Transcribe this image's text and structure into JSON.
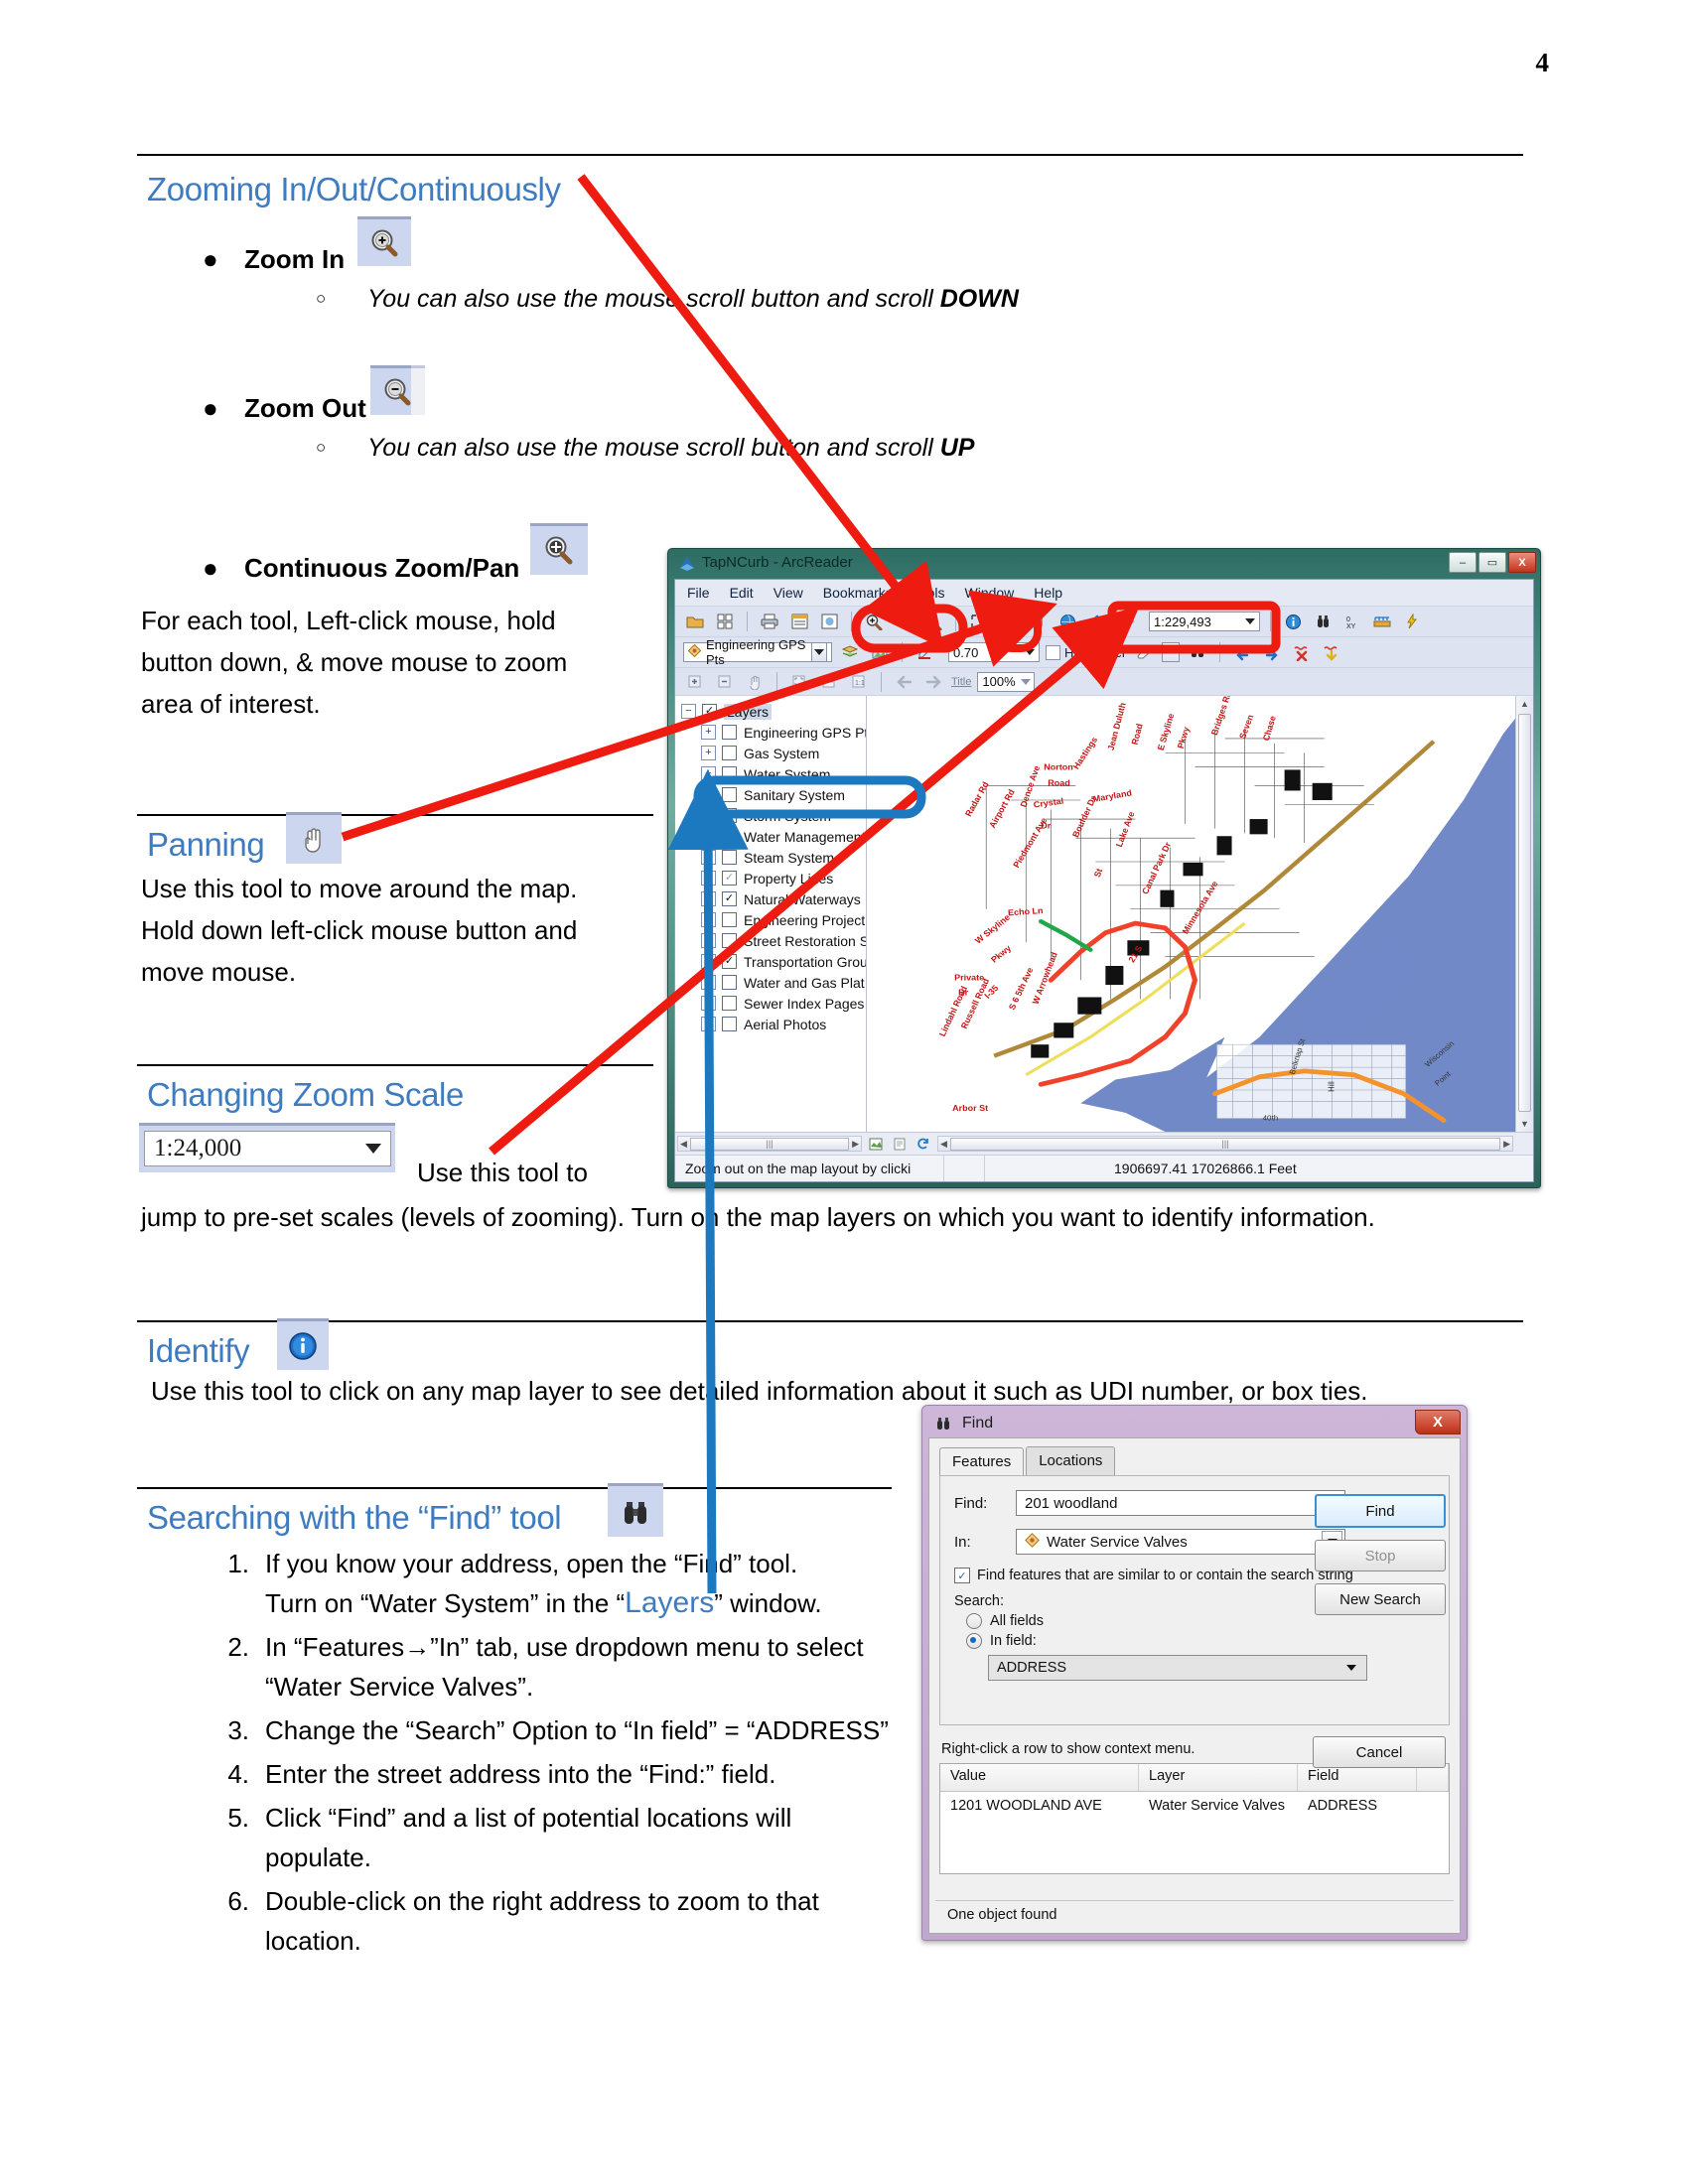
{
  "page": {
    "number": "4"
  },
  "sections": {
    "zooming": {
      "heading": "Zooming In/Out/Continuously",
      "items": [
        {
          "label": "Zoom In",
          "icon": "zoom-in-icon",
          "note_pre": "You can also use the mouse scroll button and scroll ",
          "note_em": "DOWN"
        },
        {
          "label": "Zoom Out",
          "icon": "zoom-out-icon",
          "note_pre": "You can also use the mouse scroll button and scroll ",
          "note_em": "UP"
        },
        {
          "label": "Continuous Zoom/Pan",
          "icon": "continuous-zoom-pan-icon",
          "note_pre": "",
          "note_em": ""
        }
      ],
      "paragraph": "For each tool, Left-click mouse, hold button down, & move mouse to zoom area of interest."
    },
    "panning": {
      "heading": "Panning",
      "icon": "pan-hand-icon",
      "paragraph": "Use this tool to move around the map. Hold down left-click mouse button and move mouse."
    },
    "zoom_scale": {
      "heading": "Changing Zoom Scale",
      "scale_value": "1:24,000",
      "paragraph_a": "Use this tool to",
      "paragraph_b": "jump to pre-set scales (levels of zooming).  Turn on the map layers on which you want to identify information."
    },
    "identify": {
      "heading": "Identify",
      "icon": "identify-info-icon",
      "paragraph": "Use this tool to click on any map layer to see detailed information about it such as UDI number, or box ties."
    },
    "find": {
      "heading": "Searching with the “Find” tool",
      "icon": "binoculars-icon",
      "steps": [
        {
          "n": "1.",
          "text_a": "If you know your address, open the “Find” tool.",
          "text_b_pre": "Turn on “Water System” in the “",
          "text_b_blue": "Layers",
          "text_b_post": "” window."
        },
        {
          "n": "2.",
          "text_a": "In “Features→”In” tab, use dropdown menu to select “Water Service Valves”."
        },
        {
          "n": "3.",
          "text_a": "Change the “Search” Option to “In field” = “ADDRESS”"
        },
        {
          "n": "4.",
          "text_a": "Enter the street address into the “Find:” field."
        },
        {
          "n": "5.",
          "text_a": "Click “Find” and a list of potential locations will populate."
        },
        {
          "n": "6.",
          "text_a": "Double-click on the right address to zoom to that location."
        }
      ]
    }
  },
  "arcreader": {
    "title": "TapNCurb - ArcReader",
    "window_buttons": {
      "minimize": "–",
      "maximize": "▭",
      "close": "X"
    },
    "menu": [
      "File",
      "Edit",
      "View",
      "Bookmarks",
      "Tools",
      "Window",
      "Help"
    ],
    "toolbar_icons": [
      "open-icon",
      "pages-icon",
      "print-icon",
      "content-icon",
      "layout-icon",
      "zoom-in-icon",
      "zoom-out-icon",
      "continuous-zoom-pan-icon",
      "fixed-zoom-in-icon",
      "full-extent-icon",
      "pan-hand-icon",
      "globe-icon",
      "back-extent-icon",
      "forward-extent-icon"
    ],
    "scale_value": "1:229,493",
    "right_tool_icons": [
      "identify-info-icon",
      "binoculars-icon",
      "xy-icon",
      "measure-icon",
      "hyperlink-icon"
    ],
    "layer_combo_value": "Engineering GPS Pts",
    "line_width_value": "0.70",
    "highlighter_label": "Highlighter",
    "zoom_percent_label": "Title",
    "zoom_percent_value": "100%",
    "toc": {
      "root": "Layers",
      "layers": [
        {
          "label": "Engineering GPS Pts",
          "checked": false
        },
        {
          "label": "Gas System",
          "checked": false
        },
        {
          "label": "Water System",
          "checked": false,
          "highlight": true
        },
        {
          "label": "Sanitary System",
          "checked": false
        },
        {
          "label": "Storm System",
          "checked": false
        },
        {
          "label": "Water Management Featu",
          "checked": false
        },
        {
          "label": "Steam System",
          "checked": false
        },
        {
          "label": "Property Lines",
          "checked": "gray"
        },
        {
          "label": "Natural Waterways",
          "checked": true
        },
        {
          "label": "Engineering Project Areas",
          "checked": false
        },
        {
          "label": "Street Restoration Sites",
          "checked": false
        },
        {
          "label": "Transportation Group",
          "checked": true
        },
        {
          "label": "Water and Gas Plat Index",
          "checked": false
        },
        {
          "label": "Sewer Index Pages",
          "checked": false
        },
        {
          "label": "Aerial Photos",
          "checked": false
        }
      ]
    },
    "map_labels": [
      "Radar Rd",
      "Airport Rd",
      "Dence Ave",
      "Norton Road",
      "Crystal",
      "Dr",
      "Maryland",
      "Hastings",
      "Jean Duluth Road",
      "E Skyline Pkwy",
      "Bridges Rd",
      "Seven Ave",
      "Chase",
      "Boulder Dr",
      "Piedmont Ave",
      "Echo Ln",
      "W Skyline Pkwy",
      "Private Dr",
      "I-35",
      "S 6 5th Ave",
      "W Arrowhead",
      "Russell Road",
      "Lindahl Road",
      "Arbor St",
      "Canal Park Dr",
      "Minnesota Ave",
      "21 S",
      "Wisconsin Point",
      "Belknap St",
      "40th",
      "Hill"
    ],
    "status": {
      "message": "Zoom out on the map layout by clicki",
      "coordinates": "1906697.41  17026866.1 Feet"
    }
  },
  "find_dialog": {
    "title": "Find",
    "close_label": "X",
    "tabs": [
      {
        "label": "Features",
        "active": true
      },
      {
        "label": "Locations",
        "active": false
      }
    ],
    "find_label": "Find:",
    "find_value": "201 woodland",
    "in_label": "In:",
    "in_value": "Water Service Valves",
    "similar_checkbox": "Find features that are similar to or contain the search string",
    "search_label": "Search:",
    "all_fields_label": "All fields",
    "in_field_label": "In field:",
    "field_value": "ADDRESS",
    "buttons": {
      "find": "Find",
      "stop": "Stop",
      "new_search": "New Search",
      "cancel": "Cancel"
    },
    "hint": "Right-click a row to show context menu.",
    "grid": {
      "columns": [
        "Value",
        "Layer",
        "Field",
        ""
      ],
      "rows": [
        [
          "1201 WOODLAND AVE",
          "Water Service Valves",
          "ADDRESS",
          ""
        ]
      ]
    },
    "status": "One object found"
  },
  "annotations": {
    "arrow_color_red": "#ee1b11",
    "arrow_color_blue": "#1c79c0",
    "highlight_box_red": "#ee1b11",
    "highlight_box_blue": "#1c79c0"
  }
}
